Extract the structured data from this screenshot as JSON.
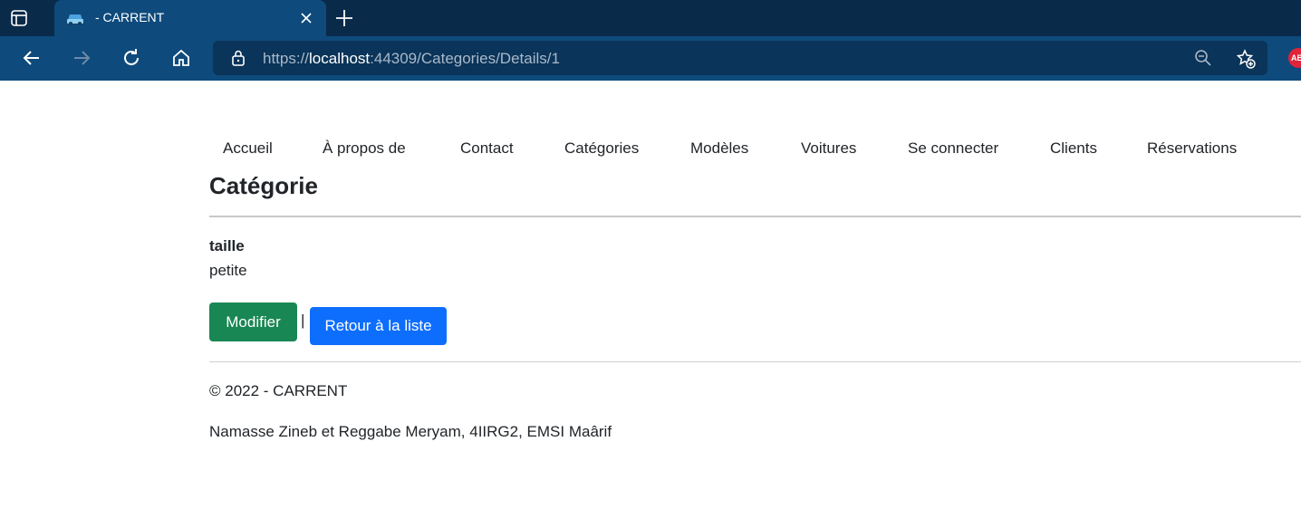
{
  "browser": {
    "tab_title": "- CARRENT",
    "url_prefix": "https://",
    "url_host": "localhost",
    "url_rest": ":44309/Categories/Details/1",
    "extension_badge": "AB"
  },
  "nav": {
    "items": [
      "Accueil",
      "À propos de",
      "Contact",
      "Catégories",
      "Modèles",
      "Voitures",
      "Se connecter",
      "Clients",
      "Réservations"
    ]
  },
  "main": {
    "title": "Catégorie",
    "field_label": "taille",
    "field_value": "petite",
    "edit_label": "Modifier",
    "separator": "|",
    "back_label": "Retour à la liste"
  },
  "footer": {
    "copyright": "© 2022 - CARRENT",
    "authors": "Namasse Zineb et Reggabe Meryam, 4IIRG2, EMSI Maârif"
  },
  "colors": {
    "chrome_dark": "#0a2a4a",
    "chrome_blue": "#0e4a7c",
    "edit_green": "#198754",
    "back_blue": "#0d6efd"
  }
}
